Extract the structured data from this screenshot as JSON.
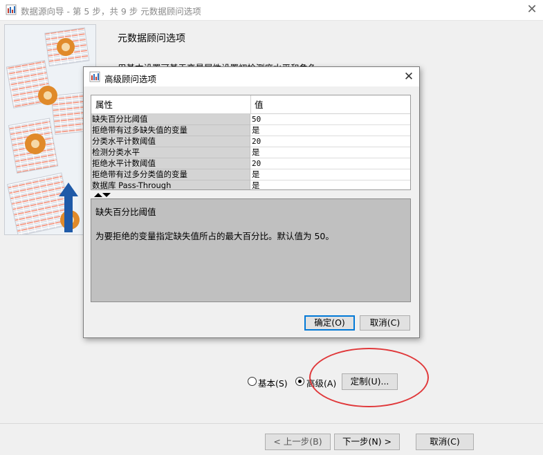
{
  "window": {
    "title": "数据源向导 - 第 5 步，共 9 步 元数据顾问选项",
    "close_label": "✕"
  },
  "page": {
    "heading": "元数据顾问选项",
    "description_partial": "用基本设置可基于变量属性设置初检测度水平和角色"
  },
  "options": {
    "basic_label": "基本(S)",
    "advanced_label": "高级(A)",
    "selected": "advanced",
    "customize_label": "定制(U)..."
  },
  "nav": {
    "back_label": "< 上一步(B)",
    "next_label": "下一步(N) >",
    "cancel_label": "取消(C)"
  },
  "dialog": {
    "title": "高级顾问选项",
    "close_label": "✕",
    "columns": [
      "属性",
      "值"
    ],
    "rows": [
      {
        "property": "缺失百分比阈值",
        "value": "50"
      },
      {
        "property": "拒绝带有过多缺失值的变量",
        "value": "是"
      },
      {
        "property": "分类水平计数阈值",
        "value": "20"
      },
      {
        "property": "检测分类水平",
        "value": "是"
      },
      {
        "property": "拒绝水平计数阈值",
        "value": "20"
      },
      {
        "property": "拒绝带有过多分类值的变量",
        "value": "是"
      },
      {
        "property": "数据库 Pass-Through",
        "value": "是"
      }
    ],
    "description_title": "缺失百分比阈值",
    "description_text": "为要拒绝的变量指定缺失值所占的最大百分比。默认值为 50。",
    "ok_label": "确定(O)",
    "cancel_label": "取消(C)"
  },
  "colors": {
    "highlight_oval": "#e0383a",
    "default_button_border": "#0078d7",
    "grid_key_bg": "#d4d4d4",
    "description_bg": "#c0c0c0"
  }
}
